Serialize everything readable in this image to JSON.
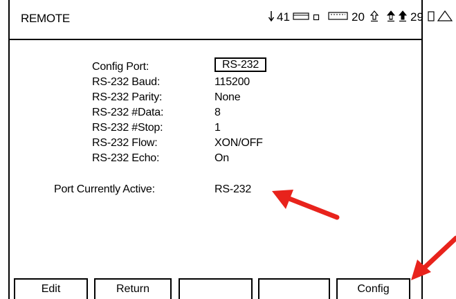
{
  "header": {
    "mode": "REMOTE",
    "status": [
      {
        "icon": "arrow-down-icon",
        "value": "41"
      },
      {
        "icon": "tray-icon",
        "value": ""
      },
      {
        "icon": "small-square-icon",
        "value": ""
      },
      {
        "icon": "battery-icon",
        "value": "20"
      },
      {
        "icon": "arrow-up-outline-icon",
        "value": ""
      },
      {
        "icon": "arrow-up-bar-icon",
        "value": ""
      },
      {
        "icon": "arrow-up-solid-icon",
        "value": "29"
      },
      {
        "icon": "rectangle-icon",
        "value": ""
      },
      {
        "icon": "triangle-icon",
        "value": ""
      }
    ]
  },
  "config": {
    "rows": [
      {
        "label": "Config Port:",
        "value": "RS-232"
      },
      {
        "label": "RS-232 Baud:",
        "value": "115200"
      },
      {
        "label": "RS-232 Parity:",
        "value": "None"
      },
      {
        "label": "RS-232 #Data:",
        "value": "8"
      },
      {
        "label": "RS-232 #Stop:",
        "value": "1"
      },
      {
        "label": "RS-232 Flow:",
        "value": "XON/OFF"
      },
      {
        "label": "RS-232 Echo:",
        "value": "On"
      }
    ],
    "active_label": "Port Currently Active:",
    "active_value": "RS-232"
  },
  "softkeys": [
    "Edit",
    "Return",
    "",
    "",
    "Config"
  ],
  "colors": {
    "arrow": "#e8231c",
    "ink": "#000000",
    "background": "#ffffff"
  }
}
